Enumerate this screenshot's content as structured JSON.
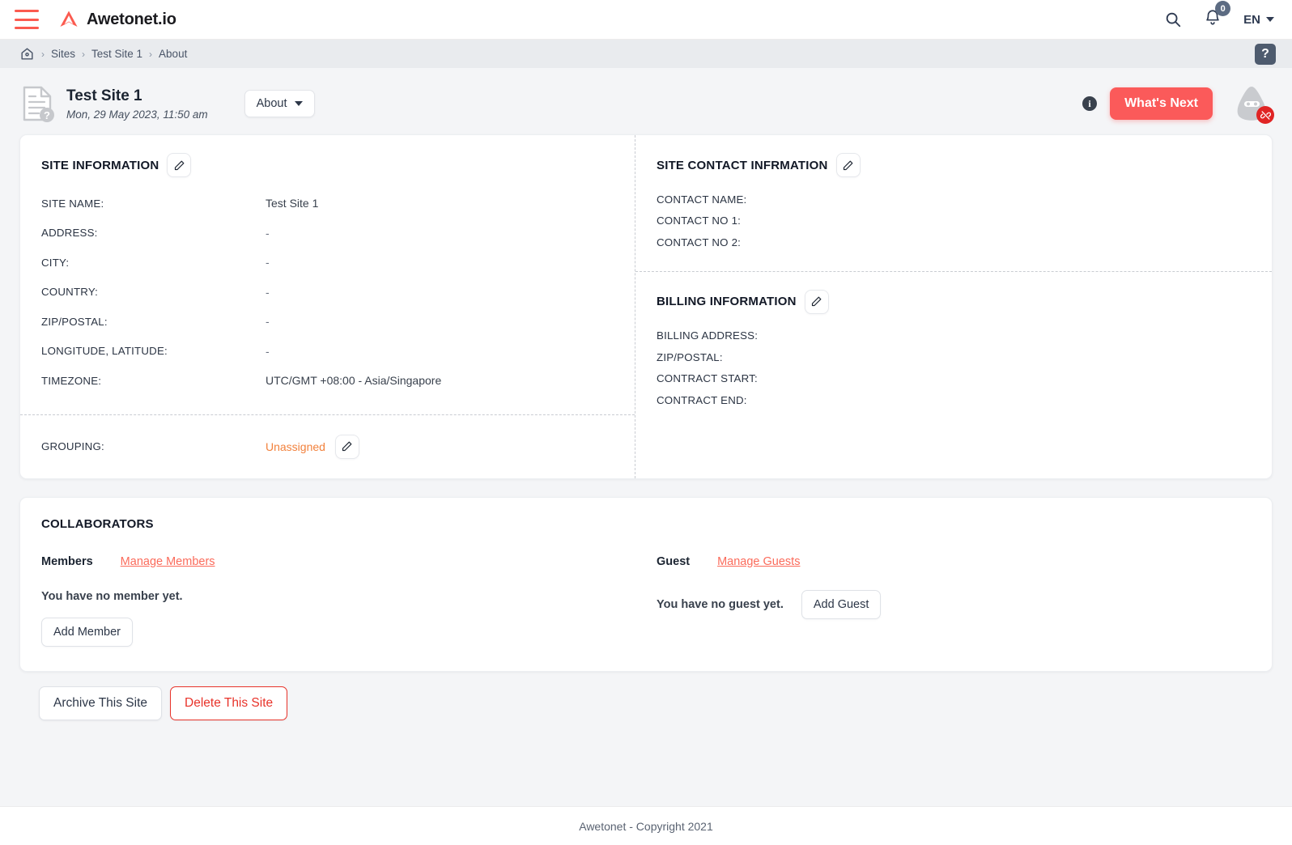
{
  "topbar": {
    "menu_icon": "hamburger-icon",
    "brand_name": "Awetonet.io",
    "search_icon": "search-icon",
    "bell_icon": "bell-icon",
    "notification_count": "0",
    "language": "EN"
  },
  "breadcrumb": {
    "home_icon": "home-icon",
    "separator": "›",
    "items": [
      {
        "label": "Sites"
      },
      {
        "label": "Test Site 1"
      },
      {
        "label": "About"
      }
    ],
    "help_label": "?"
  },
  "pagehead": {
    "doc_icon": "document-question-icon",
    "title": "Test Site 1",
    "subtitle": "Mon, 29 May 2023, 11:50 am",
    "dropdown_label": "About",
    "info_label": "i",
    "whats_next_label": "What's Next",
    "mascot_icon": "mascot-avatar-icon",
    "mascot_badge_icon": "broken-link-icon",
    "accent_color": "#fb5a5a"
  },
  "site_information": {
    "title": "SITE INFORMATION",
    "edit_icon": "pencil-icon",
    "rows": [
      {
        "label": "SITE NAME:",
        "value": "Test Site 1"
      },
      {
        "label": "ADDRESS:",
        "value": "-"
      },
      {
        "label": "CITY:",
        "value": "-"
      },
      {
        "label": "COUNTRY:",
        "value": "-"
      },
      {
        "label": "ZIP/POSTAL:",
        "value": "-"
      },
      {
        "label": "LONGITUDE, LATITUDE:",
        "value": "-"
      },
      {
        "label": "TIMEZONE:",
        "value": "UTC/GMT +08:00 - Asia/Singapore"
      }
    ],
    "grouping_label": "GROUPING:",
    "grouping_value": "Unassigned",
    "grouping_color": "#f2813c",
    "grouping_edit_icon": "pencil-icon"
  },
  "site_contact": {
    "title": "SITE CONTACT INFRMATION",
    "edit_icon": "pencil-icon",
    "rows": [
      {
        "label": "CONTACT NAME:",
        "value": ""
      },
      {
        "label": "CONTACT NO 1:",
        "value": ""
      },
      {
        "label": "CONTACT NO 2:",
        "value": ""
      }
    ]
  },
  "billing_information": {
    "title": "BILLING INFORMATION",
    "edit_icon": "pencil-icon",
    "rows": [
      {
        "label": "BILLING ADDRESS:",
        "value": ""
      },
      {
        "label": "ZIP/POSTAL:",
        "value": ""
      },
      {
        "label": "CONTRACT START:",
        "value": ""
      },
      {
        "label": "CONTRACT END:",
        "value": ""
      }
    ]
  },
  "collaborators": {
    "title": "COLLABORATORS",
    "members": {
      "kind_label": "Members",
      "manage_label": "Manage Members",
      "empty_text": "You have no member yet.",
      "add_label": "Add Member"
    },
    "guest": {
      "kind_label": "Guest",
      "manage_label": "Manage Guests",
      "empty_text": "You have no guest yet.",
      "add_label": "Add Guest"
    },
    "link_color": "#fb6b5b"
  },
  "actions": {
    "archive_label": "Archive This Site",
    "delete_label": "Delete This Site",
    "delete_color": "#e8332a"
  },
  "footer": {
    "text": "Awetonet - Copyright 2021"
  }
}
